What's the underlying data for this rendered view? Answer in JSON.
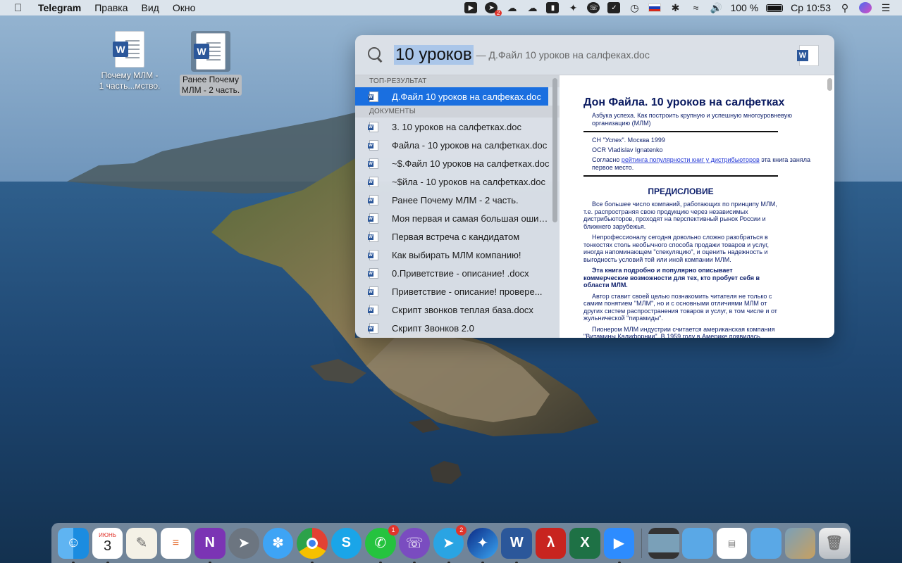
{
  "menubar": {
    "app_name": "Telegram",
    "menus": [
      "Правка",
      "Вид",
      "Окно"
    ],
    "status_icons": [
      "zoom-icon",
      "telegram-badge-icon",
      "cloud-upload-icon",
      "cloud-upload-icon-2",
      "bookmark-icon",
      "swift-icon",
      "viber-icon",
      "checkmark-icon",
      "time-machine-icon",
      "russian-flag-icon",
      "bluetooth-icon",
      "wifi-icon",
      "volume-icon"
    ],
    "telegram_badge": "2",
    "battery_text": "100 %",
    "clock": "Ср 10:53"
  },
  "desktop": {
    "icons": [
      {
        "label_line1": "Почему МЛМ -",
        "label_line2": "1 часть...мство.",
        "selected": false
      },
      {
        "label_line1": "Ранее Почему",
        "label_line2": "МЛМ - 2 часть.",
        "selected": true
      }
    ]
  },
  "spotlight": {
    "query": "10 уроков",
    "hint": "— Д.Файл 10 уроков на салфеках.doc",
    "sections": {
      "top": "ТОП-РЕЗУЛЬТАТ",
      "documents": "ДОКУМЕНТЫ"
    },
    "top_result": "Д.Файл 10 уроков на салфеках.doc",
    "documents": [
      "3. 10 уроков на салфетках.doc",
      "Файла - 10 уроков на салфетках.doc",
      "~$.Файл 10 уроков на салфетках.doc",
      "~$йла - 10 уроков на салфетках.doc",
      "Ранее Почему МЛМ - 2 часть.",
      "Моя первая и самая большая ошиб...",
      "Первая встреча с кандидатом",
      " Как выбирать МЛМ компанию!",
      "0.Приветствие - описание! .docx",
      "Приветствие - описание! провере...",
      "Скрипт звонков теплая база.docx",
      "Скрипт Звонков 2.0"
    ],
    "preview": {
      "title": "Дон Файла. 10 уроков на салфетках",
      "subtitle": "Азбука успеха. Как построить крупную и успешную многоуровневую организацию (МЛМ)",
      "line1": "СН \"Успех\". Москва 1999",
      "line2": "OCR Vladislav Ignatenko",
      "line3_prefix": "Согласно ",
      "line3_link": "рейтинга популярности книг у дистрибьюторов",
      "line3_suffix": " эта книга заняла первое место.",
      "heading": "ПРЕДИСЛОВИЕ",
      "paragraphs": [
        "Все большее число компаний, работающих по принципу МЛМ, т.е. распространяя свою продукцию через независимых дистрибьюторов, проходят на перспективный рынок России и ближнего зарубежья.",
        "Непрофессионалу сегодня довольно сложно разобраться в тонкостях столь необычного способа продажи товаров и услуг, иногда напоминающем \"спекуляцию\", и оценить надежность и выгодность условий той или иной компании МЛМ.",
        "Эта книга подробно и популярно описывает коммерческие возможности для тех, кто пробует себя в области МЛМ.",
        "Автор ставит своей целью познакомить читателя не только с самим понятием \"МЛМ\", но и с основными отличиями МЛМ от других систем распространения товаров и услуг, в том числе и от жульнической \"пирамиды\".",
        "Пионером МЛМ индустрии считается американская компания \"Витамины Калифорнии\". В 1959 году в Америке появилась компания \"Amway\", которая и сегодня является лидером МЛМ индустрии, хотя не занимается непосредственно производством продукции, что довольно непопулярно в большом бизнесе."
      ]
    }
  },
  "dock": {
    "calendar_month": "ИЮНЬ",
    "calendar_day": "3",
    "whatsapp_badge": "1",
    "telegram_badge": "2",
    "onenote_letter": "N",
    "skype_letter": "S",
    "word_letter": "W",
    "excel_letter": "X"
  }
}
